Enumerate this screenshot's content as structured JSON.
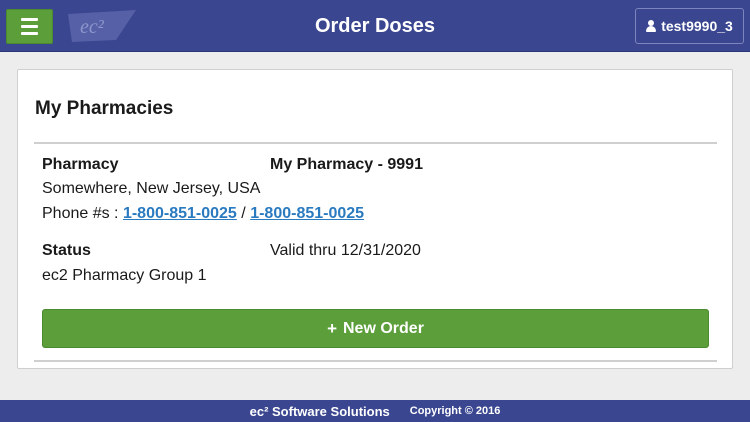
{
  "header": {
    "menu_icon": "hamburger-menu-icon",
    "logo_text": "ec²",
    "title": "Order Doses",
    "user_label": "test9990_3",
    "user_icon": "user-icon"
  },
  "card": {
    "title": "My Pharmacies",
    "pharmacy_label": "Pharmacy",
    "pharmacy_name": "My Pharmacy - 9991",
    "location": "Somewhere, New Jersey, USA",
    "phone_label": "Phone #s :",
    "phone_1": "1-800-851-0025",
    "phone_separator": "/",
    "phone_2": "1-800-851-0025",
    "status_label": "Status",
    "status_value": "Valid thru 12/31/2020",
    "group": "ec2 Pharmacy Group 1",
    "new_order_icon": "+",
    "new_order_label": "New Order"
  },
  "footer": {
    "brand": "ec² Software Solutions",
    "copyright": "Copyright © 2016"
  },
  "colors": {
    "header_bg": "#3a4690",
    "accent_green": "#5b9e3a",
    "link_blue": "#2a7ac0"
  }
}
